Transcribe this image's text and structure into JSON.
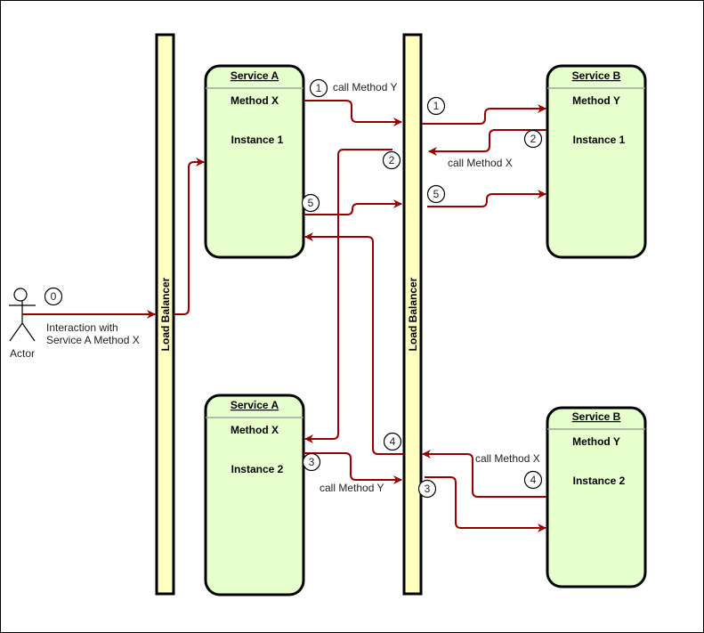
{
  "actor": {
    "label": "Actor"
  },
  "load_balancers": [
    {
      "label": "Load Balancer"
    },
    {
      "label": "Load Balancer"
    }
  ],
  "services": [
    {
      "title": "Service A",
      "method": "Method X",
      "instance": "Instance 1"
    },
    {
      "title": "Service A",
      "method": "Method X",
      "instance": "Instance 2"
    },
    {
      "title": "Service B",
      "method": "Method Y",
      "instance": "Instance 1"
    },
    {
      "title": "Service B",
      "method": "Method Y",
      "instance": "Instance 2"
    }
  ],
  "steps": {
    "s0": "0",
    "s1": "1",
    "s2": "2",
    "s3": "3",
    "s4": "4",
    "s5": "5"
  },
  "labels": {
    "interaction_line1": "Interaction with",
    "interaction_line2": "Service A Method X",
    "call_y": "call Method Y",
    "call_x": "call Method X"
  },
  "colors": {
    "arrow": "#990000",
    "load_balancer": "#ffffc0",
    "service": "#e6ffcc"
  }
}
